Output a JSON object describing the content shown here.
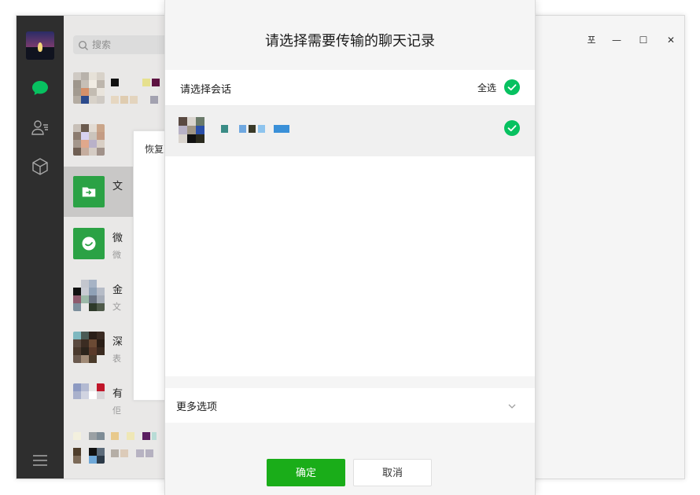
{
  "main_window": {
    "search_placeholder": "搜索",
    "popup_behind_text": "恢复到手",
    "window_controls": {
      "pin": "포",
      "minimize": "—",
      "maximize": "☐",
      "close": "✕"
    }
  },
  "dialog": {
    "title": "请选择需要传输的聊天记录",
    "section_label": "请选择会话",
    "select_all_label": "全选",
    "more_options_label": "更多选项",
    "confirm_label": "确定",
    "cancel_label": "取消"
  },
  "colors": {
    "wechat_green": "#07c160",
    "button_green": "#1aad19",
    "sidebar_dark": "#2e2e2e"
  },
  "icons": {
    "sidebar": [
      "chat-icon",
      "contacts-icon",
      "cube-icon",
      "menu-icon"
    ],
    "search": "search-icon",
    "check": "check-circle-icon",
    "chevron": "chevron-down-icon"
  }
}
